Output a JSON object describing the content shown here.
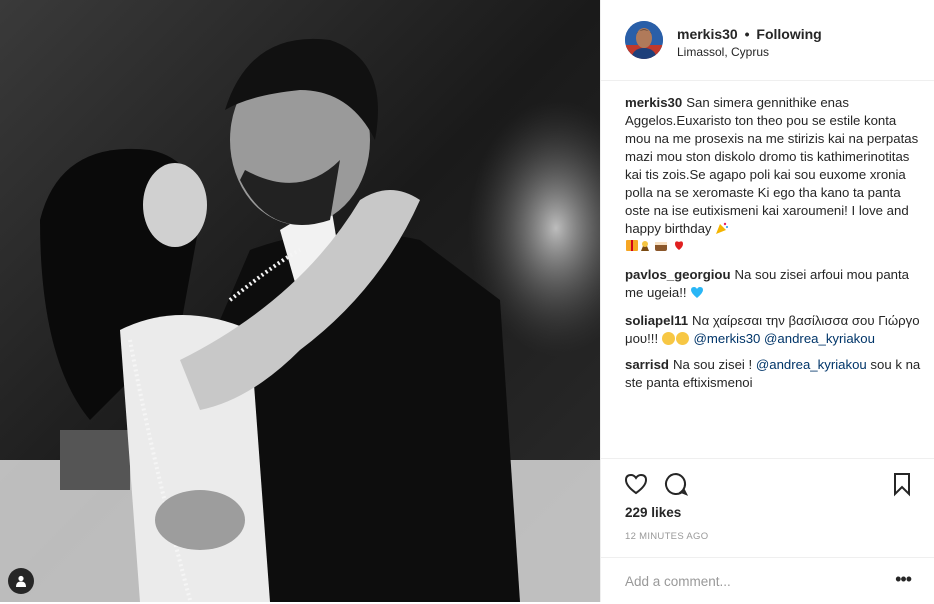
{
  "post": {
    "username": "merkis30",
    "separator": "•",
    "follow_status": "Following",
    "location": "Limassol, Cyprus"
  },
  "comments": [
    {
      "user": "merkis30",
      "text": "San simera gennithike enas Aggelos.Euxaristo ton theo pou se estile konta mou na me prosexis na me stirizis kai na perpatas mazi mou ston diskolo dromo tis kathimerinotitas kai tis zois.Se agapo poli kai sou euxome xronia polla na se xeromaste Ki ego tha kano ta panta oste na ise eutixismeni kai xaroumeni! I love and happy birthday"
    },
    {
      "user": "pavlos_georgiou",
      "text": "Na sou zisei arfoui mou panta me ugeia!!"
    },
    {
      "user": "soliapel11",
      "text": "Να χαίρεσαι την βασίλισσα σου Γιώργο μου!!!",
      "mention1": "@merkis30",
      "mention2": "@andrea_kyriakou"
    },
    {
      "user": "sarrisd",
      "text_before": "Na sou zisei !",
      "mention": "@andrea_kyriakou",
      "text_after": "sou k na ste panta eftixismenoi"
    }
  ],
  "actions": {
    "likes": "229 likes",
    "timestamp": "12 MINUTES AGO",
    "comment_placeholder": "Add a comment...",
    "more_label": "•••"
  },
  "icons": {
    "like": "heart-icon",
    "comment": "comment-bubble-icon",
    "save": "bookmark-icon",
    "tag": "user-tag-icon"
  },
  "colors": {
    "mention": "#003569",
    "muted": "#999999",
    "text": "#262626",
    "border": "#efefef"
  }
}
